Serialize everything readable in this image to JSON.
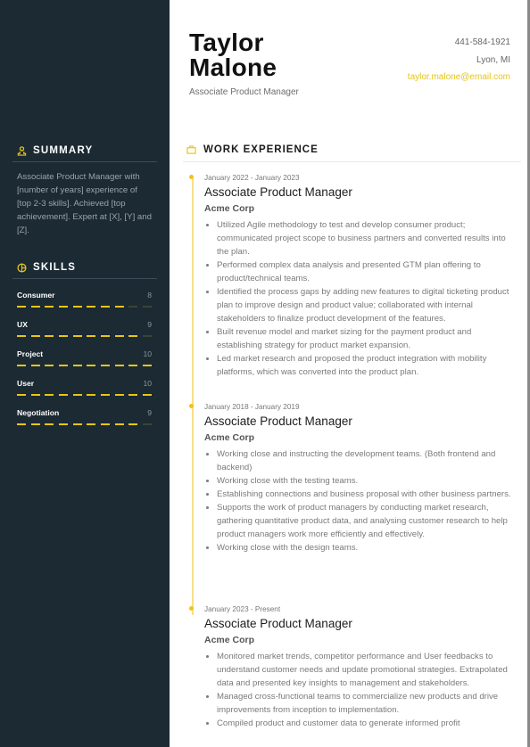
{
  "header": {
    "first_name": "Taylor",
    "last_name": "Malone",
    "title": "Associate Product Manager",
    "phone": "441-584-1921",
    "location": "Lyon, MI",
    "email": "taylor.malone@email.com"
  },
  "colors": {
    "sidebar_bg": "#1b2a33",
    "accent": "#e8c617"
  },
  "summary": {
    "heading": "SUMMARY",
    "icon": "person-icon",
    "text": "Associate Product Manager with [number of years] experience of [top 2-3 skills]. Achieved [top achievement]. Expert at [X], [Y] and [Z]."
  },
  "skills": {
    "heading": "SKILLS",
    "icon": "skills-icon",
    "max": 10,
    "items": [
      {
        "name": "Consumer",
        "value": "8"
      },
      {
        "name": "UX",
        "value": "9"
      },
      {
        "name": "Project",
        "value": "10"
      },
      {
        "name": "User",
        "value": "10"
      },
      {
        "name": "Negotiation",
        "value": "9"
      }
    ]
  },
  "work": {
    "heading": "WORK EXPERIENCE",
    "icon": "briefcase-icon",
    "jobs": [
      {
        "dates": "January 2022 - January 2023",
        "title": "Associate Product Manager",
        "company": "Acme Corp",
        "bullets": [
          "Utilized Agile methodology to test and develop consumer product; communicated project scope to business partners and converted results into the plan.",
          "Performed complex data analysis and presented GTM plan offering to product/technical teams.",
          "Identified the process gaps by adding new features to digital ticketing product plan to improve design and product value; collaborated with internal stakeholders to finalize product development of the features.",
          "Built revenue model and market sizing for the payment product and establishing strategy for product market expansion.",
          "Led market research and proposed the product integration with mobility platforms, which was converted into the product plan."
        ]
      },
      {
        "dates": "January 2018 - January 2019",
        "title": "Associate Product Manager",
        "company": "Acme Corp",
        "bullets": [
          "Working close and instructing the development teams. (Both frontend and backend)",
          "Working close with the testing teams.",
          "Establishing connections and business proposal with other business partners.",
          "Supports the work of product managers by conducting market research, gathering quantitative product data, and analysing customer research to help product managers work more efficiently and effectively.",
          "Working close with the design teams."
        ]
      },
      {
        "dates": "January 2023 - Present",
        "title": "Associate Product Manager",
        "company": "Acme Corp",
        "bullets": [
          "Monitored market trends, competitor performance and User feedbacks to understand customer needs and update promotional strategies. Extrapolated data and presented key insights to management and stakeholders.",
          "Managed cross-functional teams to commercialize new products and drive improvements from inception to implementation.",
          "Compiled product and customer data to generate informed profit"
        ]
      }
    ]
  }
}
